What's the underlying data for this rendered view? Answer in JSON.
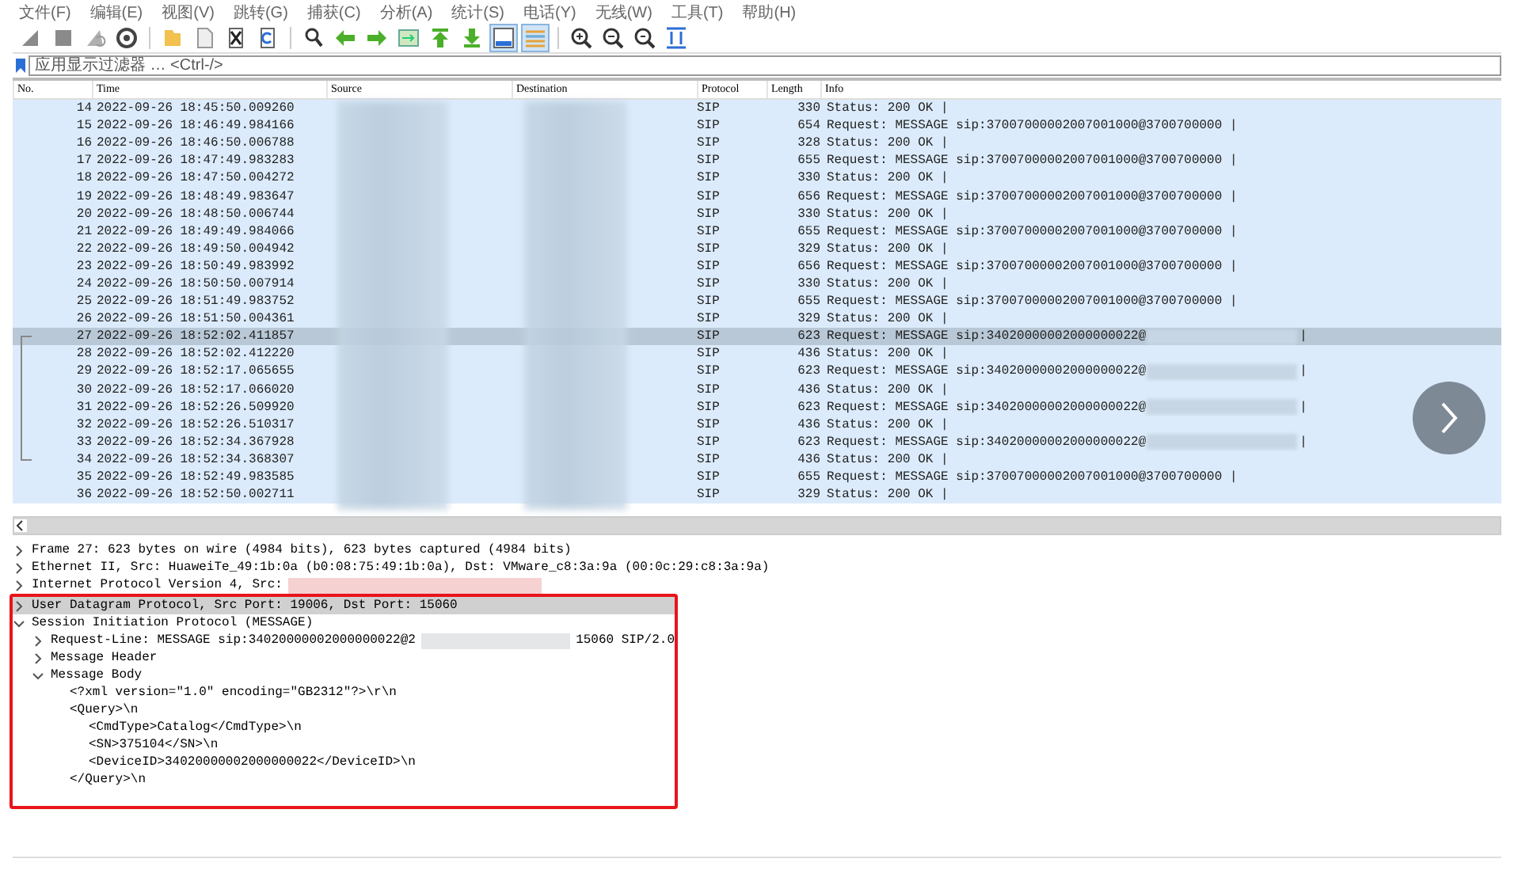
{
  "menu": [
    "文件(F)",
    "编辑(E)",
    "视图(V)",
    "跳转(G)",
    "捕获(C)",
    "分析(A)",
    "统计(S)",
    "电话(Y)",
    "无线(W)",
    "工具(T)",
    "帮助(H)"
  ],
  "filter": {
    "placeholder": "应用显示过滤器 … <Ctrl-/>"
  },
  "packet_list": {
    "columns": [
      "No.",
      "Time",
      "Source",
      "Destination",
      "Protocol",
      "Length",
      "Info"
    ],
    "rows": [
      {
        "no": "14",
        "time": "2022-09-26 18:45:50.009260",
        "protocol": "SIP",
        "length": "330",
        "info": "Status: 200 OK |",
        "selected": false,
        "related": false
      },
      {
        "no": "15",
        "time": "2022-09-26 18:46:49.984166",
        "protocol": "SIP",
        "length": "654",
        "info": "Request: MESSAGE sip:37007000002007001000@3700700000 |",
        "selected": false,
        "related": false
      },
      {
        "no": "16",
        "time": "2022-09-26 18:46:50.006788",
        "protocol": "SIP",
        "length": "328",
        "info": "Status: 200 OK |",
        "selected": false,
        "related": false
      },
      {
        "no": "17",
        "time": "2022-09-26 18:47:49.983283",
        "protocol": "SIP",
        "length": "655",
        "info": "Request: MESSAGE sip:37007000002007001000@3700700000 |",
        "selected": false,
        "related": false
      },
      {
        "no": "18",
        "time": "2022-09-26 18:47:50.004272",
        "protocol": "SIP",
        "length": "330",
        "info": "Status: 200 OK |",
        "selected": false,
        "related": false
      },
      {
        "no": "19",
        "time": "2022-09-26 18:48:49.983647",
        "protocol": "SIP",
        "length": "656",
        "info": "Request: MESSAGE sip:37007000002007001000@3700700000 |",
        "selected": false,
        "related": false
      },
      {
        "no": "20",
        "time": "2022-09-26 18:48:50.006744",
        "protocol": "SIP",
        "length": "330",
        "info": "Status: 200 OK |",
        "selected": false,
        "related": false
      },
      {
        "no": "21",
        "time": "2022-09-26 18:49:49.984066",
        "protocol": "SIP",
        "length": "655",
        "info": "Request: MESSAGE sip:37007000002007001000@3700700000 |",
        "selected": false,
        "related": false
      },
      {
        "no": "22",
        "time": "2022-09-26 18:49:50.004942",
        "protocol": "SIP",
        "length": "329",
        "info": "Status: 200 OK |",
        "selected": false,
        "related": false
      },
      {
        "no": "23",
        "time": "2022-09-26 18:50:49.983992",
        "protocol": "SIP",
        "length": "656",
        "info": "Request: MESSAGE sip:37007000002007001000@3700700000 |",
        "selected": false,
        "related": false
      },
      {
        "no": "24",
        "time": "2022-09-26 18:50:50.007914",
        "protocol": "SIP",
        "length": "330",
        "info": "Status: 200 OK |",
        "selected": false,
        "related": false
      },
      {
        "no": "25",
        "time": "2022-09-26 18:51:49.983752",
        "protocol": "SIP",
        "length": "655",
        "info": "Request: MESSAGE sip:37007000002007001000@3700700000 |",
        "selected": false,
        "related": false
      },
      {
        "no": "26",
        "time": "2022-09-26 18:51:50.004361",
        "protocol": "SIP",
        "length": "329",
        "info": "Status: 200 OK |",
        "selected": false,
        "related": false
      },
      {
        "no": "27",
        "time": "2022-09-26 18:52:02.411857",
        "protocol": "SIP",
        "length": "623",
        "info": "Request: MESSAGE sip:34020000002000000022@",
        "info_end": "|",
        "selected": true,
        "related": true
      },
      {
        "no": "28",
        "time": "2022-09-26 18:52:02.412220",
        "protocol": "SIP",
        "length": "436",
        "info": "Status: 200 OK |",
        "selected": false,
        "related": true
      },
      {
        "no": "29",
        "time": "2022-09-26 18:52:17.065655",
        "protocol": "SIP",
        "length": "623",
        "info": "Request: MESSAGE sip:34020000002000000022@",
        "info_end": "|",
        "selected": false,
        "related": true
      },
      {
        "no": "30",
        "time": "2022-09-26 18:52:17.066020",
        "protocol": "SIP",
        "length": "436",
        "info": "Status: 200 OK |",
        "selected": false,
        "related": true
      },
      {
        "no": "31",
        "time": "2022-09-26 18:52:26.509920",
        "protocol": "SIP",
        "length": "623",
        "info": "Request: MESSAGE sip:34020000002000000022@",
        "info_end": "|",
        "selected": false,
        "related": true
      },
      {
        "no": "32",
        "time": "2022-09-26 18:52:26.510317",
        "protocol": "SIP",
        "length": "436",
        "info": "Status: 200 OK |",
        "selected": false,
        "related": true
      },
      {
        "no": "33",
        "time": "2022-09-26 18:52:34.367928",
        "protocol": "SIP",
        "length": "623",
        "info": "Request: MESSAGE sip:34020000002000000022@",
        "info_end": "|",
        "selected": false,
        "related": true
      },
      {
        "no": "34",
        "time": "2022-09-26 18:52:34.368307",
        "protocol": "SIP",
        "length": "436",
        "info": "Status: 200 OK |",
        "selected": false,
        "related": true
      },
      {
        "no": "35",
        "time": "2022-09-26 18:52:49.983585",
        "protocol": "SIP",
        "length": "655",
        "info": "Request: MESSAGE sip:37007000002007001000@3700700000 |",
        "selected": false,
        "related": false
      },
      {
        "no": "36",
        "time": "2022-09-26 18:52:50.002711",
        "protocol": "SIP",
        "length": "329",
        "info": "Status: 200 OK |",
        "selected": false,
        "related": false
      }
    ]
  },
  "details": [
    {
      "text": "Frame 27: 623 bytes on wire (4984 bits), 623 bytes captured (4984 bits)",
      "expanded": false,
      "selected": false
    },
    {
      "text": "Ethernet II, Src: HuaweiTe_49:1b:0a (b0:08:75:49:1b:0a), Dst: VMware_c8:3a:9a (00:0c:29:c8:3a:9a)",
      "expanded": false,
      "selected": false
    },
    {
      "text": "Internet Protocol Version 4, Src:",
      "expanded": false,
      "selected": false,
      "redacted": true
    },
    {
      "text": "User Datagram Protocol, Src Port: 19006, Dst Port: 15060",
      "expanded": false,
      "selected": true
    },
    {
      "text": "Session Initiation Protocol (MESSAGE)",
      "expanded": true,
      "selected": false,
      "children": [
        {
          "text": "Request-Line: MESSAGE sip:34020000002000000022@2",
          "text_after": "15060 SIP/2.0",
          "expanded": false,
          "selected": false,
          "redacted": true
        },
        {
          "text": "Message Header",
          "expanded": false,
          "selected": false
        },
        {
          "text": "Message Body",
          "expanded": true,
          "selected": false,
          "children": [
            {
              "text": "<?xml version=\"1.0\" encoding=\"GB2312\"?>\\r\\n"
            },
            {
              "text": "<Query>\\n",
              "children": [
                {
                  "text": "<CmdType>Catalog</CmdType>\\n"
                },
                {
                  "text": "<SN>375104</SN>\\n"
                },
                {
                  "text": "<DeviceID>34020000002000000022</DeviceID>\\n"
                }
              ]
            },
            {
              "text": "</Query>\\n"
            }
          ]
        }
      ]
    }
  ]
}
